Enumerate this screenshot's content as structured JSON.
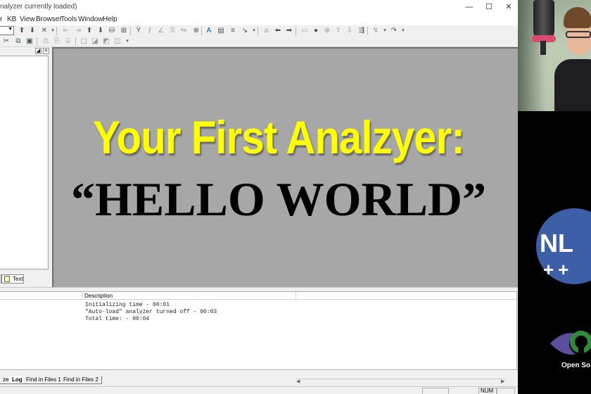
{
  "window": {
    "title": "nalyzer currently loaded)",
    "minimize_glyph": "—",
    "maximize_glyph": "☐",
    "close_glyph": "✕"
  },
  "menubar": {
    "items": [
      "r",
      "KB",
      "View",
      "Browser",
      "Tools",
      "Window",
      "Help"
    ]
  },
  "left_panel": {
    "tab_text_label": "Text"
  },
  "main_view": {
    "headline_line1": "Your First Analzyer:",
    "headline_line2": "“HELLO WORLD”",
    "headline1_color": "#ffff00",
    "background_color": "#a7a7a7"
  },
  "output": {
    "column_description": "Description",
    "log_lines": [
      "Initializing time - 00:01",
      "\"Auto-load\" analyzer turned off - 00:03",
      "Total time: - 00:04"
    ],
    "tabs": [
      "ze",
      "Log",
      "Find in Files 1",
      "Find in Files 2"
    ],
    "active_tab": "Log"
  },
  "statusbar": {
    "num_label": "NUM"
  },
  "stream": {
    "nlp_logo_text": "NL",
    "nlp_logo_plus": "++",
    "nlp_circle_color": "#3d5fa8",
    "osi_text": "Open So"
  }
}
